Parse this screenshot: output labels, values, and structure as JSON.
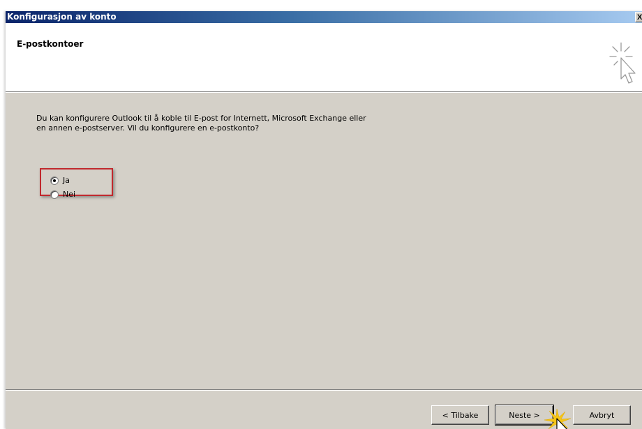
{
  "window": {
    "title": "Konfigurasjon av konto",
    "close_label": "X"
  },
  "header": {
    "title": "E-postkontoer",
    "icon": "wizard-cursor-icon"
  },
  "content": {
    "description_line1": "Du kan konfigurere Outlook til å koble til E-post for Internett, Microsoft Exchange eller",
    "description_line2": "en annen e-postserver. Vil du konfigurere en e-postkonto?",
    "options": [
      {
        "label": "Ja",
        "selected": true
      },
      {
        "label": "Nei",
        "selected": false
      }
    ]
  },
  "buttons": {
    "back": "< Tilbake",
    "next": "Neste >",
    "cancel": "Avbryt"
  },
  "colors": {
    "highlight_border": "#c0282d",
    "dialog_bg": "#d4d0c8",
    "titlebar_start": "#0a246a"
  }
}
